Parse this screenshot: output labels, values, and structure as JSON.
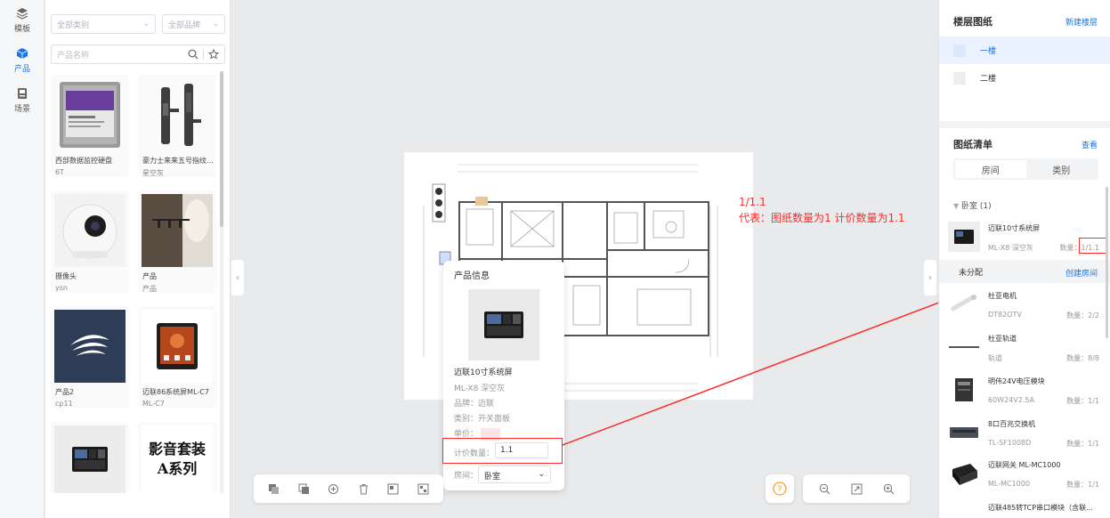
{
  "nav": {
    "items": [
      {
        "label": "模板",
        "icon": "layers-icon"
      },
      {
        "label": "产品",
        "icon": "cube-icon",
        "active": true
      },
      {
        "label": "场景",
        "icon": "scene-icon"
      }
    ]
  },
  "filters": {
    "category": "全部类别",
    "brand": "全部品牌",
    "search_placeholder": "产品名称"
  },
  "products": [
    {
      "name": "西部数据监控硬盘",
      "sub": "6T"
    },
    {
      "name": "豪力士来来五号指纹...",
      "sub": "星空灰"
    },
    {
      "name": "摄像头",
      "sub": "ysn"
    },
    {
      "name": "产品",
      "sub": "产品"
    },
    {
      "name": "产品2",
      "sub": "cp11"
    },
    {
      "name": "迈联86系统屏ML-C7",
      "sub": "ML-C7"
    },
    {
      "name": "",
      "sub": ""
    },
    {
      "name": "影音套装A系列",
      "sub": ""
    }
  ],
  "product_logo_text": "影音套装\nA系列",
  "annotation": {
    "line1": "1/1.1",
    "line2": "代表：图纸数量为1  计价数量为1.1"
  },
  "popup": {
    "title": "产品信息",
    "name": "迈联10寸系统屏",
    "model": "ML-X8 深空灰",
    "brand": "品牌：迈联",
    "category": "类别：开关面板",
    "price_label": "单价：",
    "qty_label": "计价数量：",
    "qty_value": "1.1",
    "room_label": "房间：",
    "room_value": "卧室"
  },
  "right": {
    "floors_title": "楼层图纸",
    "new_floor": "新建楼层",
    "floors": [
      {
        "label": "一楼",
        "active": true
      },
      {
        "label": "二楼",
        "active": false
      }
    ],
    "list_title": "图纸清单",
    "view": "查看",
    "tabs": [
      "房间",
      "类别"
    ],
    "group_bedroom": "卧室 (1)",
    "bedroom_items": [
      {
        "name": "迈联10寸系统屏",
        "model": "ML-X8 深空灰",
        "qty": "数量：1/1.1"
      }
    ],
    "unassigned": "未分配",
    "create_room": "创建房间",
    "unassigned_items": [
      {
        "name": "杜亚电机",
        "model": "DT82OTV",
        "qty": "数量：2/2"
      },
      {
        "name": "杜亚轨道",
        "model": "轨道",
        "qty": "数量：8/8"
      },
      {
        "name": "明伟24V电压模块",
        "model": "60W24V2.5A",
        "qty": "数量：1/1"
      },
      {
        "name": "8口百兆交换机",
        "model": "TL-SF1008D",
        "qty": "数量：1/1"
      },
      {
        "name": "迈联网关 ML-MC1000",
        "model": "ML-MC1000",
        "qty": "数量：1/1"
      },
      {
        "name": "迈联485转TCP串口模块（含联...",
        "model": "",
        "qty": ""
      }
    ]
  },
  "colors": {
    "accent": "#1a73e8",
    "annotation": "#ff2a2a"
  }
}
